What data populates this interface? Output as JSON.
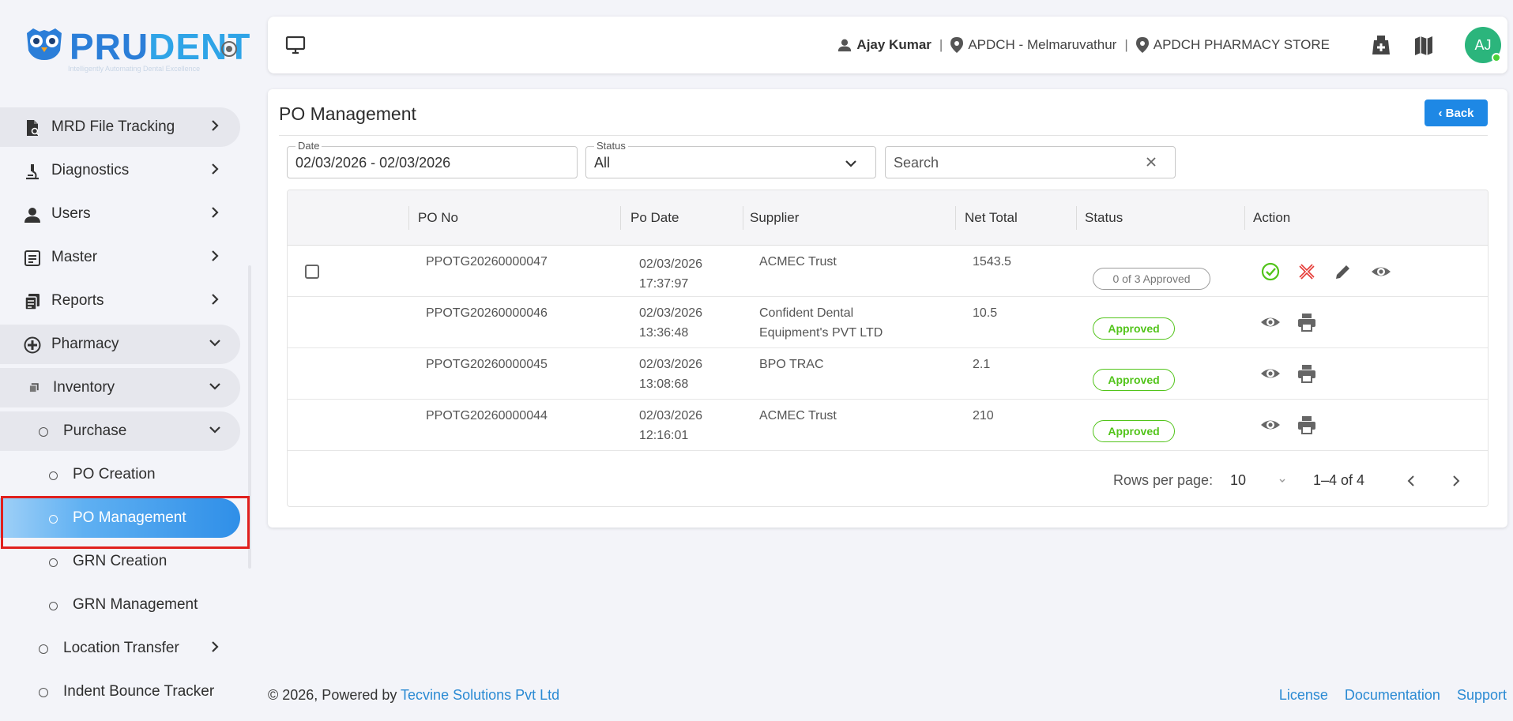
{
  "brand": {
    "logo_text_a": "PRU",
    "logo_text_b": "DENT",
    "tagline": "Intelligently Automating Dental Excellence"
  },
  "sidebar": {
    "items": [
      {
        "label": "MRD File Tracking",
        "icon": "file-tracking-icon"
      },
      {
        "label": "Diagnostics",
        "icon": "microscope-icon"
      },
      {
        "label": "Users",
        "icon": "user-icon"
      },
      {
        "label": "Master",
        "icon": "master-icon"
      },
      {
        "label": "Reports",
        "icon": "reports-icon"
      },
      {
        "label": "Pharmacy",
        "icon": "pharmacy-icon"
      },
      {
        "label": "Inventory",
        "icon": "inventory-icon"
      },
      {
        "label": "Purchase"
      },
      {
        "label": "PO Creation"
      },
      {
        "label": "PO Management"
      },
      {
        "label": "GRN Creation"
      },
      {
        "label": "GRN Management"
      },
      {
        "label": "Location Transfer"
      },
      {
        "label": "Indent Bounce Tracker"
      }
    ]
  },
  "header": {
    "user_name": "Ajay Kumar",
    "location": "APDCH - Melmaruvathur",
    "store": "APDCH PHARMACY STORE",
    "avatar_initials": "AJ"
  },
  "page": {
    "title": "PO Management",
    "back_label": "‹ Back"
  },
  "filters": {
    "date_label": "Date",
    "date_value": "02/03/2026 - 02/03/2026",
    "status_label": "Status",
    "status_value": "All",
    "search_placeholder": "Search"
  },
  "table": {
    "columns": [
      "PO No",
      "Po Date",
      "Supplier",
      "Net Total",
      "Status",
      "Action"
    ],
    "rows": [
      {
        "po_no": "PPOTG20260000047",
        "date": "02/03/2026",
        "time": "17:37:97",
        "supplier_1": "ACMEC Trust",
        "supplier_2": "",
        "net_total": "1543.5",
        "status": "0 of 3 Approved"
      },
      {
        "po_no": "PPOTG20260000046",
        "date": "02/03/2026",
        "time": "13:36:48",
        "supplier_1": "Confident Dental",
        "supplier_2": "Equipment's PVT LTD",
        "net_total": "10.5",
        "status": "Approved"
      },
      {
        "po_no": "PPOTG20260000045",
        "date": "02/03/2026",
        "time": "13:08:68",
        "supplier_1": "BPO TRAC",
        "supplier_2": "",
        "net_total": "2.1",
        "status": "Approved"
      },
      {
        "po_no": "PPOTG20260000044",
        "date": "02/03/2026",
        "time": "12:16:01",
        "supplier_1": "ACMEC Trust",
        "supplier_2": "",
        "net_total": "210",
        "status": "Approved"
      }
    ]
  },
  "pagination": {
    "rows_per_page_label": "Rows per page:",
    "rows_per_page": "10",
    "range": "1–4 of 4"
  },
  "footer": {
    "copyright": "© 2026, Powered by ",
    "company": "Tecvine Solutions Pvt Ltd",
    "links": [
      "License",
      "Documentation",
      "Support"
    ]
  },
  "colors": {
    "primary": "#1e88e5",
    "approved": "#52c41a",
    "reject": "#e53935",
    "avatar": "#2bb57c",
    "active_outline": "#e0201e"
  }
}
